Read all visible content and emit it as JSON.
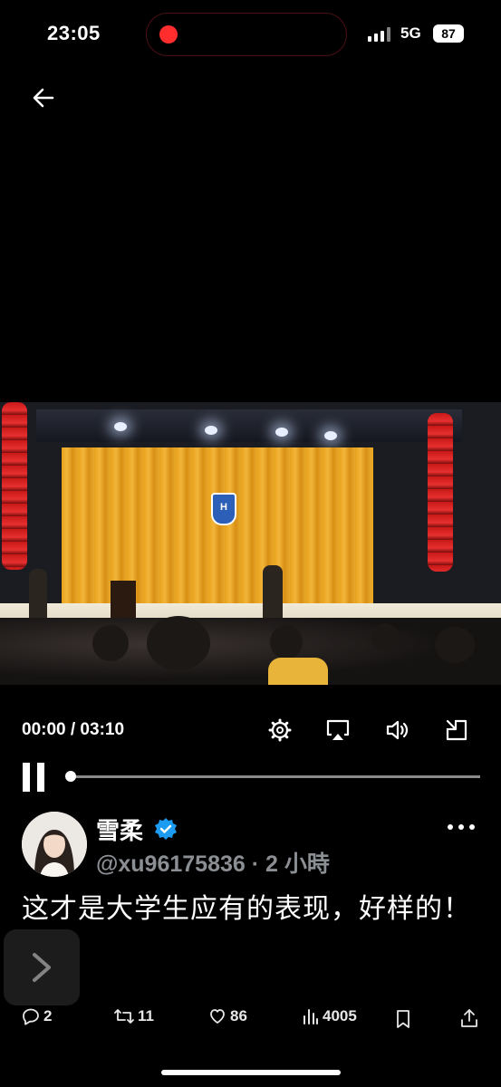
{
  "status_bar": {
    "time": "23:05",
    "network": "5G",
    "battery": "87"
  },
  "video": {
    "current_time": "00:00",
    "duration": "03:10",
    "time_display": "00:00 / 03:10",
    "progress": 0.0
  },
  "tweet": {
    "author_name": "雪柔",
    "handle_line": "@xu96175836 · 2 小時",
    "text": "这才是大学生应有的表现，好样的！",
    "stats": {
      "replies": "2",
      "retweets": "11",
      "likes": "86",
      "views": "4005"
    }
  },
  "colors": {
    "accent_blue": "#1d9bf0",
    "record_red": "#ff2d2d",
    "background": "#000000"
  }
}
